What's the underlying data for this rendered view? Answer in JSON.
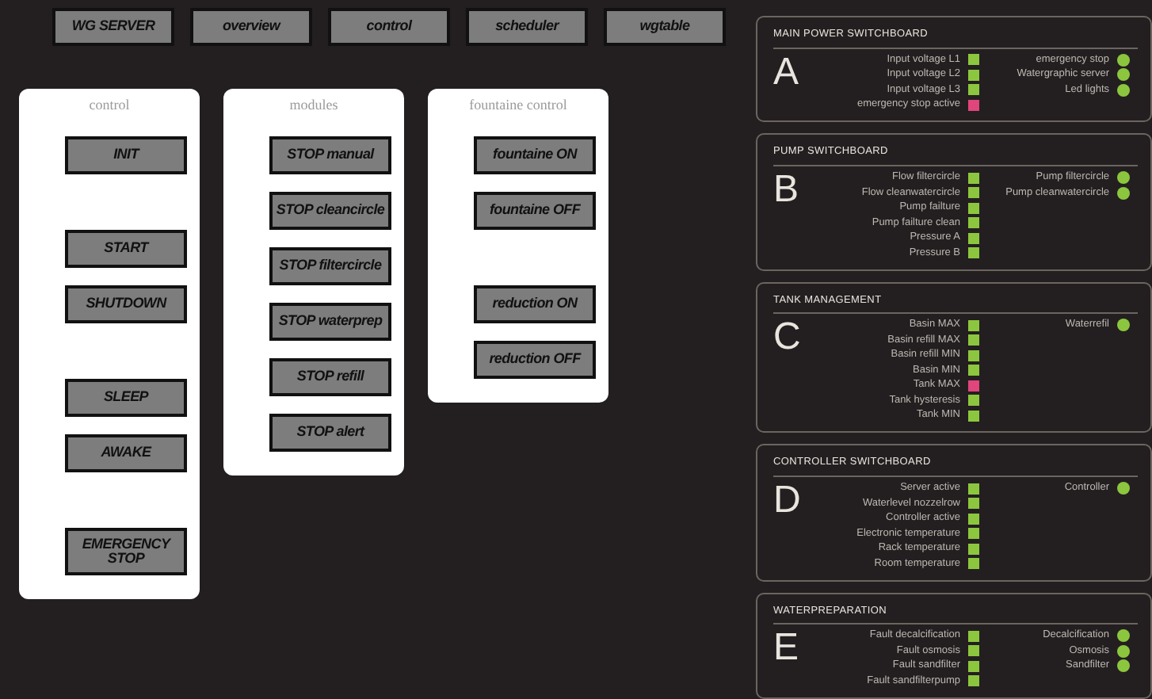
{
  "nav": [
    {
      "label": "WG SERVER"
    },
    {
      "label": "overview"
    },
    {
      "label": "control"
    },
    {
      "label": "scheduler"
    },
    {
      "label": "wgtable"
    }
  ],
  "cards": [
    {
      "title": "control",
      "groups": [
        [
          "INIT"
        ],
        [
          "START",
          "SHUTDOWN"
        ],
        [
          "SLEEP",
          "AWAKE"
        ],
        [
          "EMERGENCY STOP"
        ]
      ]
    },
    {
      "title": "modules",
      "groups": [
        [
          "STOP manual",
          "STOP cleancircle",
          "STOP filtercircle",
          "STOP waterprep",
          "STOP refill",
          "STOP alert"
        ]
      ]
    },
    {
      "title": "fountaine control",
      "groups": [
        [
          "fountaine ON",
          "fountaine OFF"
        ],
        [
          "reduction ON",
          "reduction OFF"
        ]
      ]
    }
  ],
  "panels": [
    {
      "title": "MAIN POWER SWITCHBOARD",
      "letter": "A",
      "inputs": [
        {
          "label": "Input voltage L1",
          "color": "#8cc63f"
        },
        {
          "label": "Input voltage L2",
          "color": "#8cc63f"
        },
        {
          "label": "Input voltage L3",
          "color": "#8cc63f"
        },
        {
          "label": "emergency stop active",
          "color": "#e0457b"
        }
      ],
      "outputs": [
        {
          "label": "emergency stop",
          "color": "#8cc63f"
        },
        {
          "label": "Watergraphic server",
          "color": "#8cc63f"
        },
        {
          "label": "Led lights",
          "color": "#8cc63f"
        }
      ]
    },
    {
      "title": "PUMP SWITCHBOARD",
      "letter": "B",
      "inputs": [
        {
          "label": "Flow filtercircle",
          "color": "#8cc63f"
        },
        {
          "label": "Flow cleanwatercircle",
          "color": "#8cc63f"
        },
        {
          "label": "Pump failture",
          "color": "#8cc63f"
        },
        {
          "label": "Pump failture clean",
          "color": "#8cc63f"
        },
        {
          "label": "Pressure A",
          "color": "#8cc63f"
        },
        {
          "label": "Pressure B",
          "color": "#8cc63f"
        }
      ],
      "outputs": [
        {
          "label": "Pump filtercircle",
          "color": "#8cc63f"
        },
        {
          "label": "Pump cleanwatercircle",
          "color": "#8cc63f"
        }
      ]
    },
    {
      "title": "TANK MANAGEMENT",
      "letter": "C",
      "inputs": [
        {
          "label": "Basin MAX",
          "color": "#8cc63f"
        },
        {
          "label": "Basin refill MAX",
          "color": "#8cc63f"
        },
        {
          "label": "Basin refill MIN",
          "color": "#8cc63f"
        },
        {
          "label": "Basin MIN",
          "color": "#8cc63f"
        },
        {
          "label": "Tank MAX",
          "color": "#e0457b"
        },
        {
          "label": "Tank hysteresis",
          "color": "#8cc63f"
        },
        {
          "label": "Tank MIN",
          "color": "#8cc63f"
        }
      ],
      "outputs": [
        {
          "label": "Waterrefil",
          "color": "#8cc63f"
        }
      ]
    },
    {
      "title": "CONTROLLER SWITCHBOARD",
      "letter": "D",
      "inputs": [
        {
          "label": "Server active",
          "color": "#8cc63f"
        },
        {
          "label": "Waterlevel nozzelrow",
          "color": "#8cc63f"
        },
        {
          "label": "Controller active",
          "color": "#8cc63f"
        },
        {
          "label": "Electronic temperature",
          "color": "#8cc63f"
        },
        {
          "label": "Rack temperature",
          "color": "#8cc63f"
        },
        {
          "label": "Room temperature",
          "color": "#8cc63f"
        }
      ],
      "outputs": [
        {
          "label": "Controller",
          "color": "#8cc63f"
        }
      ]
    },
    {
      "title": "WATERPREPARATION",
      "letter": "E",
      "inputs": [
        {
          "label": "Fault decalcification",
          "color": "#8cc63f"
        },
        {
          "label": "Fault osmosis",
          "color": "#8cc63f"
        },
        {
          "label": "Fault sandfilter",
          "color": "#8cc63f"
        },
        {
          "label": "Fault sandfilterpump",
          "color": "#8cc63f"
        }
      ],
      "outputs": [
        {
          "label": "Decalcification",
          "color": "#8cc63f"
        },
        {
          "label": "Osmosis",
          "color": "#8cc63f"
        },
        {
          "label": "Sandfilter",
          "color": "#8cc63f"
        }
      ]
    }
  ]
}
